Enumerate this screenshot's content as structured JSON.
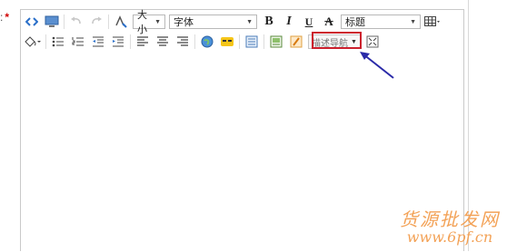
{
  "field": {
    "colon": ":",
    "required_mark": "*"
  },
  "toolbar": {
    "font_size": {
      "label": "大小"
    },
    "font_family": {
      "label": "字体"
    },
    "heading": {
      "label": "标题"
    },
    "describe_nav": {
      "label": "描述导航"
    }
  },
  "icons": {
    "source": "code-icon",
    "preview": "monitor-icon",
    "undo": "undo-icon",
    "redo": "redo-icon",
    "format_painter": "format-painter-icon",
    "bold": "bold-icon",
    "italic": "italic-icon",
    "underline": "underline-icon",
    "strike": "strikethrough-icon",
    "table": "table-icon",
    "fill": "fill-bucket-icon",
    "ul": "bulleted-list-icon",
    "ol": "numbered-list-icon",
    "outdent": "outdent-icon",
    "indent": "indent-icon",
    "align_left": "align-left-icon",
    "align_center": "align-center-icon",
    "align_right": "align-right-icon",
    "link": "globe-link-icon",
    "emoticon": "emoticon-icon",
    "template": "template-icon",
    "image": "image-icon",
    "pencil": "pencil-icon",
    "fullscreen": "fullscreen-icon"
  },
  "colors": {
    "annotation_box": "#cc1f2d",
    "annotation_arrow": "#2a2aa8",
    "watermark": "#f3a257"
  },
  "watermark": {
    "title": "货源批发网",
    "url": "www.6pf.cn"
  }
}
